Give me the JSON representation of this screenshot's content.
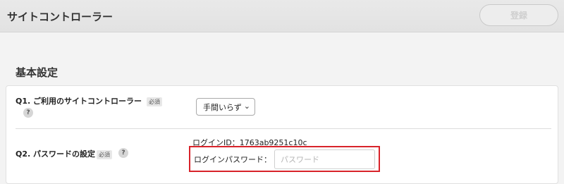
{
  "header": {
    "title": "サイトコントローラー",
    "register_label": "登録"
  },
  "section": {
    "title": "基本設定"
  },
  "q1": {
    "label": "Q1. ご利用のサイトコントローラー",
    "required": "必須",
    "help": "?",
    "select_value": "手間いらず",
    "select_icon": "chevron-down-icon"
  },
  "q2": {
    "label": "Q2. パスワードの設定",
    "required": "必須",
    "help": "?",
    "login_id": "ログインID：1763ab9251c10c",
    "password_label": "ログインパスワード：",
    "password_placeholder": "パスワード"
  },
  "colors": {
    "highlight": "#d8232a"
  }
}
